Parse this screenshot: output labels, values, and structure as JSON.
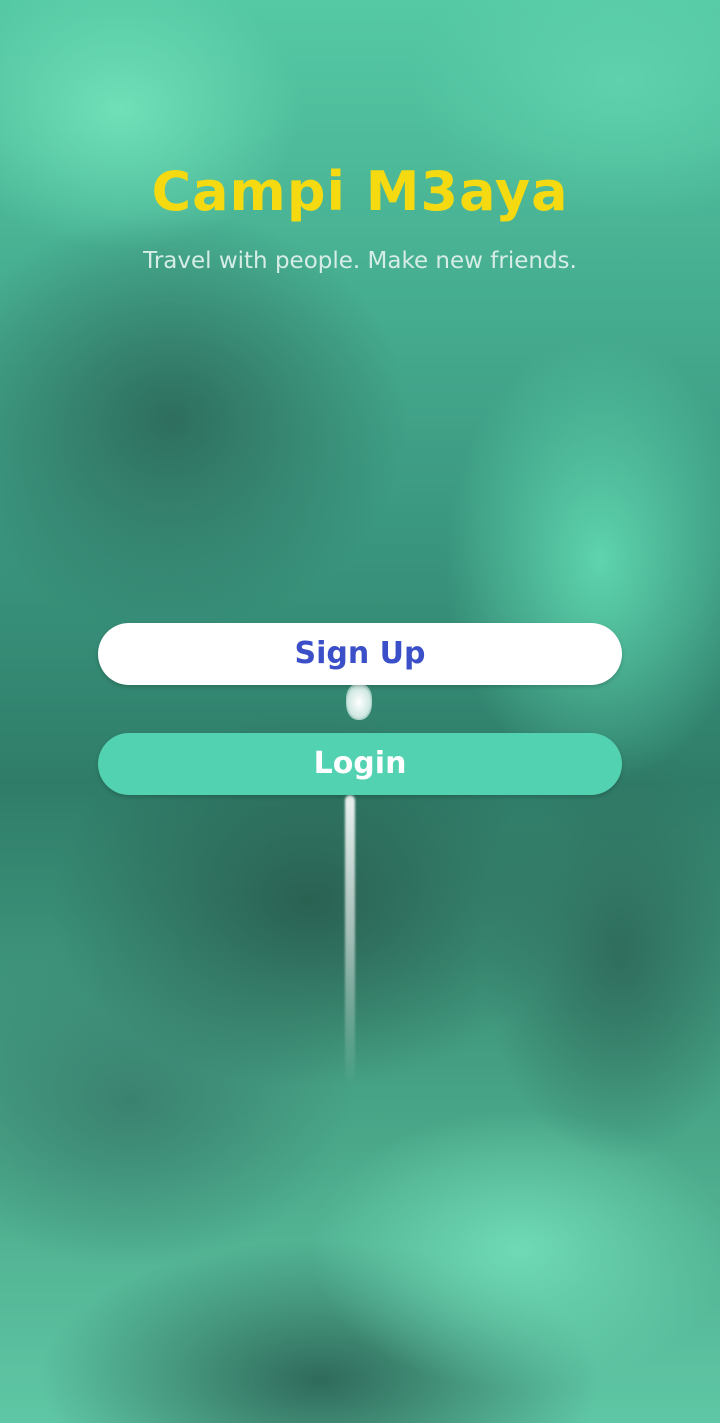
{
  "app": {
    "title": "Campi M3aya",
    "tagline": "Travel with people. Make new friends."
  },
  "actions": {
    "signup_label": "Sign Up",
    "login_label": "Login"
  },
  "colors": {
    "title": "#f5d911",
    "signup_text": "#3a4fc8",
    "signup_bg": "#ffffff",
    "login_bg": "#52d2b1",
    "login_text": "#ffffff"
  }
}
